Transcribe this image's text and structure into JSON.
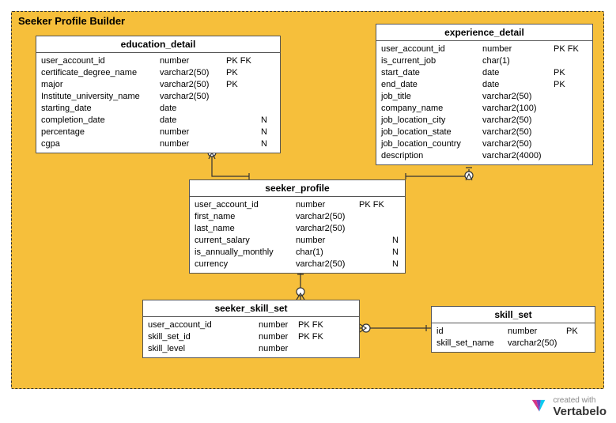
{
  "module": {
    "title": "Seeker Profile Builder"
  },
  "entities": {
    "education_detail": {
      "title": "education_detail",
      "cols": [
        {
          "name": "user_account_id",
          "type": "number",
          "flags": "PK FK",
          "n": ""
        },
        {
          "name": "certificate_degree_name",
          "type": "varchar2(50)",
          "flags": "PK",
          "n": ""
        },
        {
          "name": "major",
          "type": "varchar2(50)",
          "flags": "PK",
          "n": ""
        },
        {
          "name": "Institute_university_name",
          "type": "varchar2(50)",
          "flags": "",
          "n": ""
        },
        {
          "name": "starting_date",
          "type": "date",
          "flags": "",
          "n": ""
        },
        {
          "name": "completion_date",
          "type": "date",
          "flags": "",
          "n": "N"
        },
        {
          "name": "percentage",
          "type": "number",
          "flags": "",
          "n": "N"
        },
        {
          "name": "cgpa",
          "type": "number",
          "flags": "",
          "n": "N"
        }
      ]
    },
    "experience_detail": {
      "title": "experience_detail",
      "cols": [
        {
          "name": "user_account_id",
          "type": "number",
          "flags": "PK FK",
          "n": ""
        },
        {
          "name": "is_current_job",
          "type": "char(1)",
          "flags": "",
          "n": ""
        },
        {
          "name": "start_date",
          "type": "date",
          "flags": "PK",
          "n": ""
        },
        {
          "name": "end_date",
          "type": "date",
          "flags": "PK",
          "n": ""
        },
        {
          "name": "job_title",
          "type": "varchar2(50)",
          "flags": "",
          "n": ""
        },
        {
          "name": "company_name",
          "type": "varchar2(100)",
          "flags": "",
          "n": ""
        },
        {
          "name": "job_location_city",
          "type": "varchar2(50)",
          "flags": "",
          "n": ""
        },
        {
          "name": "job_location_state",
          "type": "varchar2(50)",
          "flags": "",
          "n": ""
        },
        {
          "name": "job_location_country",
          "type": "varchar2(50)",
          "flags": "",
          "n": ""
        },
        {
          "name": "description",
          "type": "varchar2(4000)",
          "flags": "",
          "n": ""
        }
      ]
    },
    "seeker_profile": {
      "title": "seeker_profile",
      "cols": [
        {
          "name": "user_account_id",
          "type": "number",
          "flags": "PK FK",
          "n": ""
        },
        {
          "name": "first_name",
          "type": "varchar2(50)",
          "flags": "",
          "n": ""
        },
        {
          "name": "last_name",
          "type": "varchar2(50)",
          "flags": "",
          "n": ""
        },
        {
          "name": "current_salary",
          "type": "number",
          "flags": "",
          "n": "N"
        },
        {
          "name": "is_annually_monthly",
          "type": "char(1)",
          "flags": "",
          "n": "N"
        },
        {
          "name": "currency",
          "type": "varchar2(50)",
          "flags": "",
          "n": "N"
        }
      ]
    },
    "seeker_skill_set": {
      "title": "seeker_skill_set",
      "cols": [
        {
          "name": "user_account_id",
          "type": "number",
          "flags": "PK FK",
          "n": ""
        },
        {
          "name": "skill_set_id",
          "type": "number",
          "flags": "PK FK",
          "n": ""
        },
        {
          "name": "skill_level",
          "type": "number",
          "flags": "",
          "n": ""
        }
      ]
    },
    "skill_set": {
      "title": "skill_set",
      "cols": [
        {
          "name": "id",
          "type": "number",
          "flags": "PK",
          "n": ""
        },
        {
          "name": "skill_set_name",
          "type": "varchar2(50)",
          "flags": "",
          "n": ""
        }
      ]
    }
  },
  "attribution": {
    "prefix": "created with",
    "brand": "Vertabelo"
  }
}
